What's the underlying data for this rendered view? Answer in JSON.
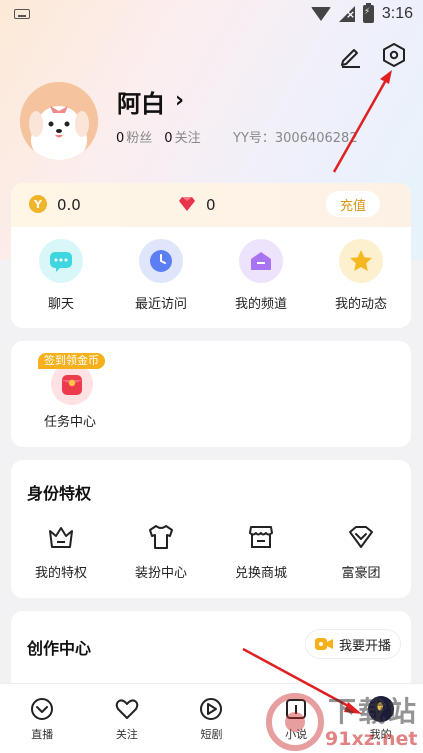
{
  "status_bar": {
    "time": "3:16"
  },
  "profile": {
    "username": "阿白",
    "fans_count": "0",
    "fans_label": "粉丝",
    "follow_count": "0",
    "follow_label": "关注",
    "yy_label": "YY号：",
    "yy_number": "3006406282"
  },
  "wallet": {
    "coins": "0.0",
    "diamonds": "0",
    "recharge_label": "充值"
  },
  "quick_actions": [
    {
      "label": "聊天",
      "icon": "chat-bubble-icon",
      "color": "#3fd6e0"
    },
    {
      "label": "最近访问",
      "icon": "clock-icon",
      "color": "#5b7ef5"
    },
    {
      "label": "我的频道",
      "icon": "channel-icon",
      "color": "#a874f2"
    },
    {
      "label": "我的动态",
      "icon": "star-icon",
      "color": "#f5b81f"
    }
  ],
  "task": {
    "badge": "签到领金币",
    "label": "任务中心"
  },
  "identity": {
    "title": "身份特权",
    "items": [
      {
        "label": "我的特权",
        "icon": "crown-icon"
      },
      {
        "label": "装扮中心",
        "icon": "tshirt-icon"
      },
      {
        "label": "兑换商城",
        "icon": "store-icon"
      },
      {
        "label": "富豪团",
        "icon": "gem-badge-icon"
      }
    ]
  },
  "creator": {
    "title": "创作中心",
    "live_label": "我要开播"
  },
  "bottom_nav": [
    {
      "label": "直播",
      "icon": "live-icon"
    },
    {
      "label": "关注",
      "icon": "heart-icon"
    },
    {
      "label": "短剧",
      "icon": "play-icon"
    },
    {
      "label": "小说",
      "icon": "book-icon"
    },
    {
      "label": "我的",
      "icon": "me-avatar-icon"
    }
  ],
  "watermark": {
    "top": "下载站",
    "bottom": "91xz.net"
  }
}
